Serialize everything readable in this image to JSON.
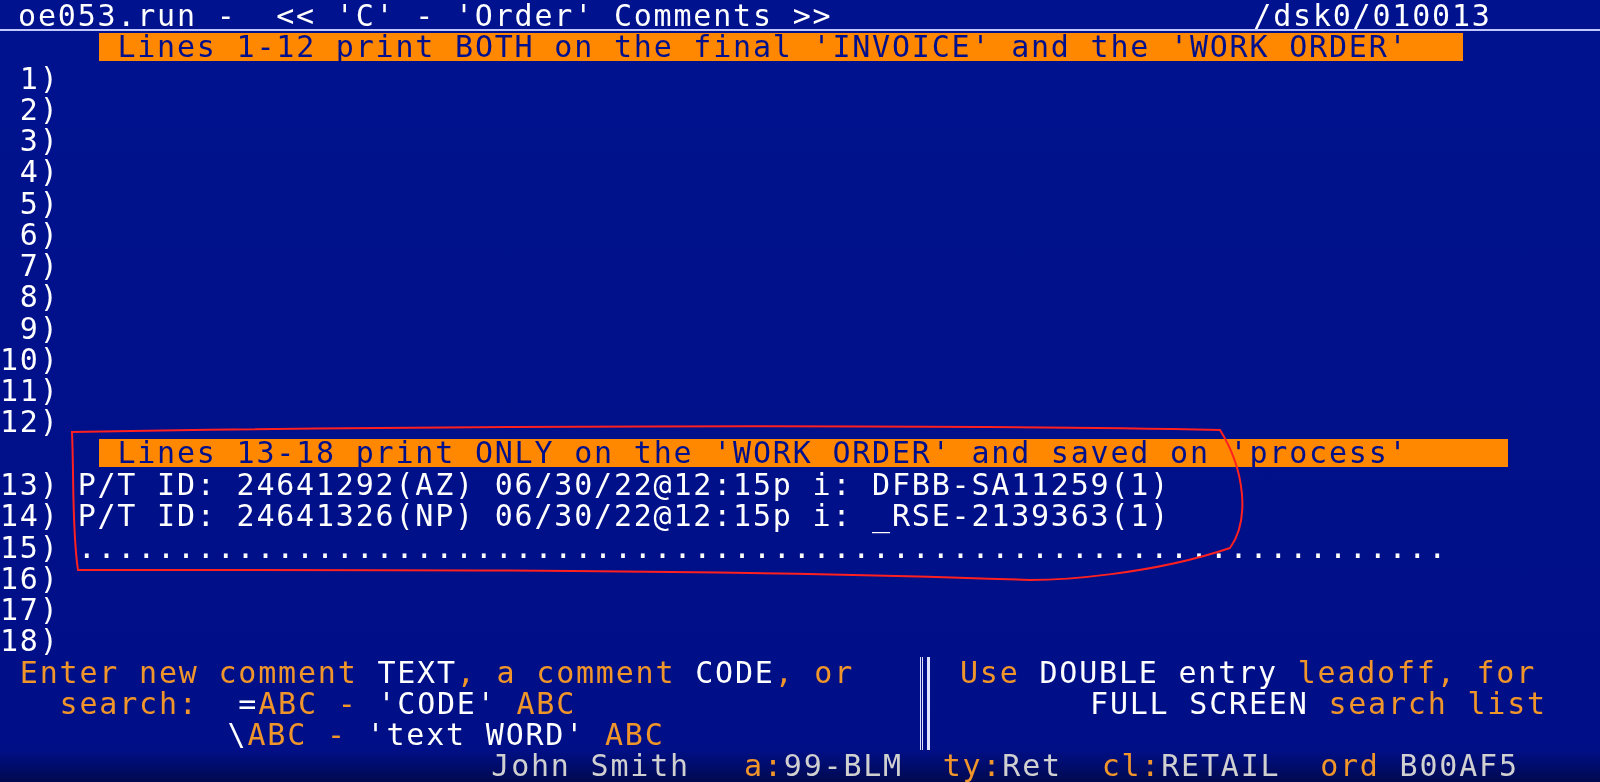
{
  "title": {
    "left": "oe053.run -  << 'C' - 'Order' Comments >>",
    "right": "/dsk0/010013"
  },
  "banners": [
    {
      "text": "Lines 1-12 print BOTH on the final 'INVOICE' and the 'WORK ORDER'"
    },
    {
      "text": "Lines 13-18 print ONLY on the 'WORK ORDER' and saved on 'process'"
    }
  ],
  "invoice_lines": [
    {
      "number": "1)"
    },
    {
      "number": "2)"
    },
    {
      "number": "3)"
    },
    {
      "number": "4)"
    },
    {
      "number": "5)"
    },
    {
      "number": "6)"
    },
    {
      "number": "7)"
    },
    {
      "number": "8)"
    },
    {
      "number": "9)"
    },
    {
      "number": "10)"
    },
    {
      "number": "11)"
    },
    {
      "number": "12)"
    }
  ],
  "work_order_lines": [
    {
      "number": "13)",
      "text": "P/T ID: 24641292(AZ) 06/30/22@12:15p i: DFBB-SA11259(1)"
    },
    {
      "number": "14)",
      "text": "P/T ID: 24641326(NP) 06/30/22@12:15p i: _RSE-2139363(1)"
    },
    {
      "number": "15)",
      "text": "....................................................................."
    },
    {
      "number": "16)"
    },
    {
      "number": "17)"
    },
    {
      "number": "18)"
    }
  ],
  "help_left": [
    [
      {
        "kind": "label",
        "text": "Enter new comment "
      },
      {
        "kind": "value",
        "text": "TEXT"
      },
      {
        "kind": "label",
        "text": ", a comment "
      },
      {
        "kind": "value",
        "text": "CODE"
      },
      {
        "kind": "label",
        "text": ", or"
      }
    ],
    [
      {
        "kind": "label",
        "text": "search:  "
      },
      {
        "kind": "value",
        "text": "="
      },
      {
        "kind": "label",
        "text": "ABC - "
      },
      {
        "kind": "value",
        "text": "'CODE'"
      },
      {
        "kind": "label",
        "text": " ABC"
      }
    ],
    [
      {
        "kind": "value",
        "text": "\\"
      },
      {
        "kind": "label",
        "text": "ABC - "
      },
      {
        "kind": "value",
        "text": "'text WORD'"
      },
      {
        "kind": "label",
        "text": " ABC"
      }
    ]
  ],
  "help_right": [
    [
      {
        "kind": "label",
        "text": "Use "
      },
      {
        "kind": "value",
        "text": "DOUBLE entry"
      },
      {
        "kind": "label",
        "text": " leadoff, for"
      }
    ],
    [
      {
        "kind": "value",
        "text": "FULL SCREEN"
      },
      {
        "kind": "label",
        "text": " search list"
      }
    ]
  ],
  "status": {
    "customer": "John Smith",
    "fields": [
      {
        "label": "a:",
        "value": "99-BLM"
      },
      {
        "label": "ty:",
        "value": "Ret"
      },
      {
        "label": "cl:",
        "value": "RETAIL"
      },
      {
        "label": "ord",
        "value": "B00AF5"
      }
    ]
  }
}
